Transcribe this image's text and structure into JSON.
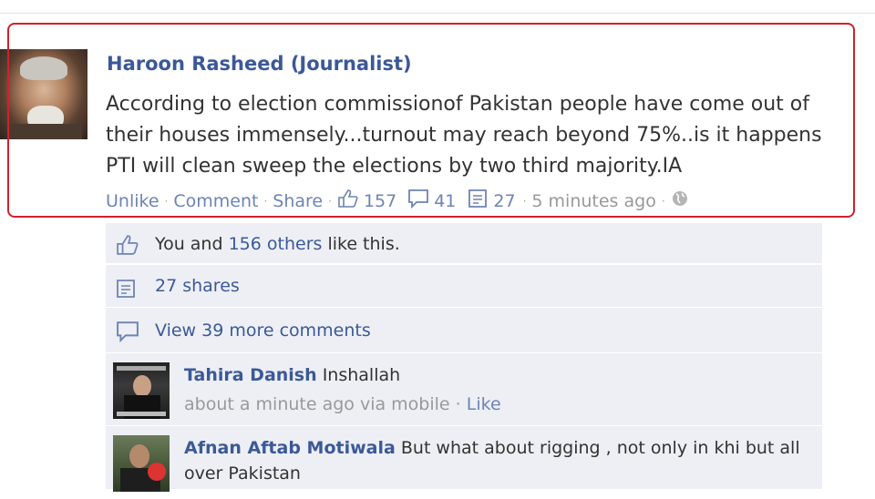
{
  "post": {
    "author": "Haroon Rasheed (Journalist)",
    "message": "According to election commissionof Pakistan people have come out of their houses immensely...turnout may reach beyond 75%..is it happens PTI will clean sweep the elections by two third majority.IA",
    "actions": {
      "unlike": "Unlike",
      "comment": "Comment",
      "share": "Share",
      "like_count": "157",
      "comment_count": "41",
      "share_count": "27",
      "time": "5 minutes ago"
    }
  },
  "ufi": {
    "likes": {
      "you_and": "You and ",
      "others_link": "156 others",
      "like_this": " like this."
    },
    "shares": {
      "label": "27 shares"
    },
    "view_more": {
      "label": "View 39 more comments"
    },
    "comments": [
      {
        "name": "Tahira Danish",
        "text": " Inshallah",
        "time": "about a minute ago via mobile",
        "like": "Like"
      },
      {
        "name": "Afnan Aftab Motiwala",
        "text": " But what about rigging , not only in khi but all over Pakistan"
      }
    ]
  },
  "colors": {
    "link": "#3b5998",
    "highlight_border": "#d0212e",
    "ufi_bg": "#edeff4"
  },
  "icons": [
    "thumbs-up-icon",
    "comment-bubble-icon",
    "share-icon",
    "globe-icon"
  ]
}
